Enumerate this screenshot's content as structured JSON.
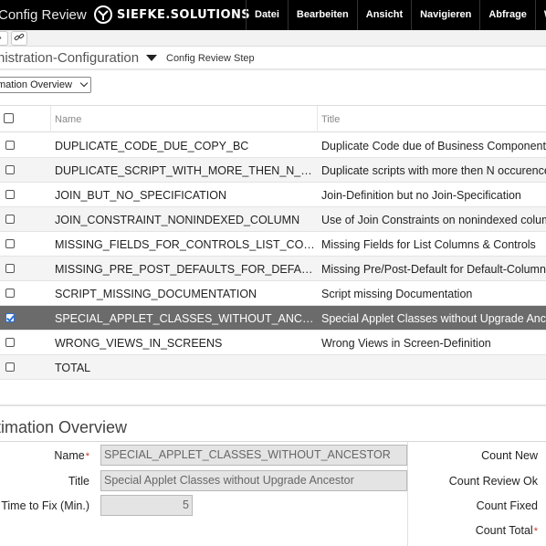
{
  "app": {
    "title": "Config Review",
    "brand": "SIEFKE.SOLUTIONS"
  },
  "menu": [
    "Datei",
    "Bearbeiten",
    "Ansicht",
    "Navigieren",
    "Abfrage",
    "We"
  ],
  "breadcrumb": {
    "title": "nistration-Configuration",
    "step": "Config Review Step"
  },
  "view_select": {
    "value": "mation Overview"
  },
  "list": {
    "columns": {
      "name": "Name",
      "title": "Title"
    },
    "rows": [
      {
        "name": "DUPLICATE_CODE_DUE_COPY_BC",
        "title": "Duplicate Code due of Business Component",
        "selected": false
      },
      {
        "name": "DUPLICATE_SCRIPT_WITH_MORE_THEN_N_OCCURENCES",
        "title": "Duplicate scripts with more then N occurences",
        "selected": false
      },
      {
        "name": "JOIN_BUT_NO_SPECIFICATION",
        "title": "Join-Definition but no Join-Specification",
        "selected": false
      },
      {
        "name": "JOIN_CONSTRAINT_NONINDEXED_COLUMN",
        "title": "Use of Join Constraints on nonindexed columns",
        "selected": false
      },
      {
        "name": "MISSING_FIELDS_FOR_CONTROLS_LIST_COLUMNS",
        "title": "Missing Fields for List Columns & Controls",
        "selected": false
      },
      {
        "name": "MISSING_PRE_POST_DEFAULTS_FOR_DEFAULT_COLUMN",
        "title": "Missing Pre/Post-Default for Default-Column",
        "selected": false
      },
      {
        "name": "SCRIPT_MISSING_DOCUMENTATION",
        "title": "Script missing Documentation",
        "selected": false
      },
      {
        "name": "SPECIAL_APPLET_CLASSES_WITHOUT_ANCESTOR",
        "title": "Special Applet Classes without Upgrade Ancestor",
        "selected": true
      },
      {
        "name": "WRONG_VIEWS_IN_SCREENS",
        "title": "Wrong Views in Screen-Definition",
        "selected": false
      },
      {
        "name": "TOTAL",
        "title": "",
        "selected": false
      }
    ]
  },
  "form": {
    "title": "timation Overview",
    "name_label": "Name",
    "name_value": "SPECIAL_APPLET_CLASSES_WITHOUT_ANCESTOR",
    "title_label": "Title",
    "title_value": "Special Applet Classes without Upgrade Ancestor",
    "time_label": "Time to Fix (Min.)",
    "time_value": "5",
    "required_mark": "*",
    "count_new": "Count New",
    "count_review_ok": "Count Review Ok",
    "count_fixed": "Count Fixed",
    "count_total": "Count Total"
  },
  "colors": {
    "topbar": "#000000",
    "selected_row": "#6b6b6b",
    "required": "#c0392b"
  }
}
